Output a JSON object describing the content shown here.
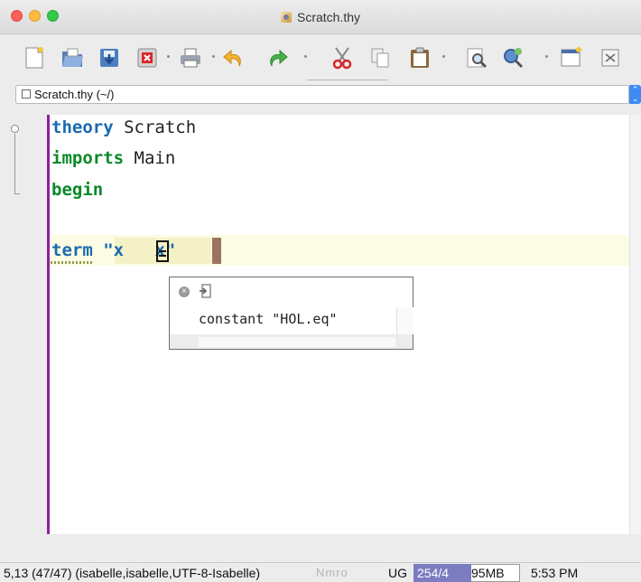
{
  "window": {
    "title": "Scratch.thy"
  },
  "buffer": {
    "label": "Scratch.thy (~/)"
  },
  "editor": {
    "line1_kw": "theory",
    "line1_rest": " Scratch",
    "line2_kw": "imports",
    "line2_rest": " Main",
    "line3_kw": "begin",
    "line5_kw": "term",
    "line5_str_open": "\"x ",
    "line5_str_close": " x\""
  },
  "popup": {
    "text": "constant \"HOL.eq\""
  },
  "status": {
    "position": "5,13 (47/47) (isabelle,isabelle,UTF-8-Isabelle)",
    "modes": "Nmro",
    "ug": "UG",
    "memory_used": "254/4",
    "memory_rest": "95MB",
    "time": "5:53 PM"
  },
  "colors": {
    "gutter_marker": "#8e1e9e",
    "keyword_blue": "#1a6ab0",
    "keyword_green": "#0a8a2a",
    "memory_bar": "#7b7dc0"
  },
  "icons": [
    "new-file-icon",
    "open-folder-icon",
    "save-icon",
    "close-buffer-icon",
    "print-icon",
    "undo-icon",
    "redo-icon",
    "cut-icon",
    "copy-icon",
    "paste-icon",
    "find-icon",
    "find-replace-icon",
    "new-view-icon",
    "unsplit-icon"
  ]
}
